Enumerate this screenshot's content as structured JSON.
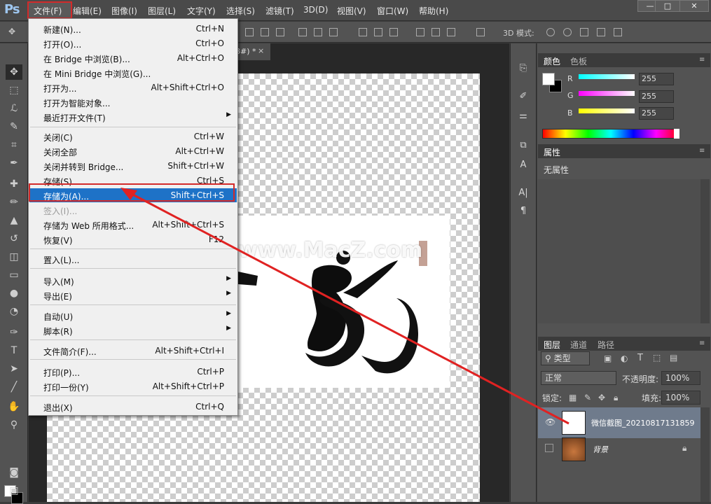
{
  "app": {
    "logo": "Ps"
  },
  "menubar": {
    "items": [
      "文件(F)",
      "编辑(E)",
      "图像(I)",
      "图层(L)",
      "文字(Y)",
      "选择(S)",
      "滤镜(T)",
      "3D(D)",
      "视图(V)",
      "窗口(W)",
      "帮助(H)"
    ],
    "window_buttons": [
      "—",
      "□",
      "✕"
    ]
  },
  "options": {
    "mode3d": "3D 模式:"
  },
  "document": {
    "tab_title": "8#) *",
    "tab_close": "×",
    "watermark": "www.MacZ.com"
  },
  "file_menu": {
    "items": [
      {
        "label": "新建(N)...",
        "shortcut": "Ctrl+N"
      },
      {
        "label": "打开(O)...",
        "shortcut": "Ctrl+O"
      },
      {
        "label": "在 Bridge 中浏览(B)...",
        "shortcut": "Alt+Ctrl+O"
      },
      {
        "label": "在 Mini Bridge 中浏览(G)...",
        "shortcut": ""
      },
      {
        "label": "打开为...",
        "shortcut": "Alt+Shift+Ctrl+O"
      },
      {
        "label": "打开为智能对象...",
        "shortcut": ""
      },
      {
        "label": "最近打开文件(T)",
        "shortcut": ""
      },
      {
        "label": "关闭(C)",
        "shortcut": "Ctrl+W"
      },
      {
        "label": "关闭全部",
        "shortcut": "Alt+Ctrl+W"
      },
      {
        "label": "关闭并转到 Bridge...",
        "shortcut": "Shift+Ctrl+W"
      },
      {
        "label": "存储(S)",
        "shortcut": "Ctrl+S"
      },
      {
        "label": "存储为(A)...",
        "shortcut": "Shift+Ctrl+S"
      },
      {
        "label": "签入(I)...",
        "shortcut": ""
      },
      {
        "label": "存储为 Web 所用格式...",
        "shortcut": "Alt+Shift+Ctrl+S"
      },
      {
        "label": "恢复(V)",
        "shortcut": "F12"
      },
      {
        "label": "置入(L)...",
        "shortcut": ""
      },
      {
        "label": "导入(M)",
        "shortcut": ""
      },
      {
        "label": "导出(E)",
        "shortcut": ""
      },
      {
        "label": "自动(U)",
        "shortcut": ""
      },
      {
        "label": "脚本(R)",
        "shortcut": ""
      },
      {
        "label": "文件简介(F)...",
        "shortcut": "Alt+Shift+Ctrl+I"
      },
      {
        "label": "打印(P)...",
        "shortcut": "Ctrl+P"
      },
      {
        "label": "打印一份(Y)",
        "shortcut": "Alt+Shift+Ctrl+P"
      },
      {
        "label": "退出(X)",
        "shortcut": "Ctrl+Q"
      }
    ]
  },
  "color_panel": {
    "tabs": [
      "颜色",
      "色板"
    ],
    "r_label": "R",
    "g_label": "G",
    "b_label": "B",
    "r": "255",
    "g": "255",
    "b": "255",
    "slider_colors": {
      "r": "#00ffff",
      "g": "#ff00ff",
      "b": "#ffff00"
    }
  },
  "properties_panel": {
    "tab": "属性",
    "content": "无属性"
  },
  "layers_panel": {
    "tabs": [
      "图层",
      "通道",
      "路径"
    ],
    "filter_kind": "类型",
    "blend_mode": "正常",
    "opacity_label": "不透明度:",
    "opacity": "100%",
    "lock_label": "锁定:",
    "fill_label": "填充:",
    "fill": "100%",
    "layers": [
      {
        "name": "微信截图_20210817131859",
        "visible": true,
        "selected": true
      },
      {
        "name": "背景",
        "visible": false,
        "selected": false
      }
    ]
  },
  "accent": {
    "highlight": "#1e72c7",
    "annotation_red": "#d32a2a"
  }
}
